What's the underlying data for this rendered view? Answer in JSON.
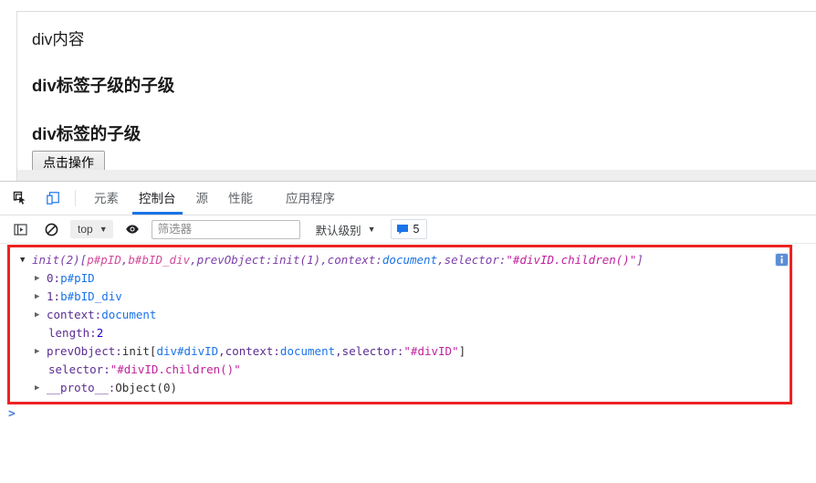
{
  "page": {
    "div_content": "div内容",
    "heading_child_of_child": "div标签子级的子级",
    "heading_child": "div标签的子级",
    "button_label": "点击操作"
  },
  "devtools": {
    "toolbar_icons": [
      {
        "name": "inspect-element-icon",
        "title": "检查元素"
      },
      {
        "name": "device-toolbar-icon",
        "title": "切换设备工具栏"
      }
    ],
    "tabs": [
      {
        "label": "元素",
        "selected": false
      },
      {
        "label": "控制台",
        "selected": true
      },
      {
        "label": "源",
        "selected": false
      },
      {
        "label": "性能",
        "selected": false
      },
      {
        "label": "应用程序",
        "selected": false
      }
    ],
    "console_toolbar": {
      "sidebar_toggle_icon": "console-sidebar-icon",
      "clear_icon": "clear-console-icon",
      "context_value": "top",
      "context_caret": "▼",
      "eye_icon": "live-expression-icon",
      "filter_placeholder": "筛选器",
      "filter_value": "",
      "levels_label": "默认级别",
      "levels_caret": "▼",
      "message_count": "5",
      "message_icon": "message-count-icon"
    },
    "console_output": {
      "line0": {
        "triangle": "▼",
        "object": "init(2)",
        "bracket_open": " [",
        "node1": "p#pID",
        "sep1": ", ",
        "node2": "b#bID_div",
        "sep2": ", ",
        "key_prev": "prevObject: ",
        "val_prev": "init(1)",
        "sep3": ", ",
        "key_ctx": "context: ",
        "val_ctx": "document",
        "sep4": ", ",
        "key_sel": "selector: ",
        "val_sel": "\"#divID.children()\"",
        "bracket_close": "]"
      },
      "rows": [
        {
          "triangle": "▶",
          "key": "0: ",
          "value": "p#pID",
          "value_kind": "node"
        },
        {
          "triangle": "▶",
          "key": "1: ",
          "value": "b#bID_div",
          "value_kind": "node"
        },
        {
          "triangle": "▶",
          "key": "context: ",
          "value": "document",
          "value_kind": "node"
        },
        {
          "triangle": "",
          "key": "length: ",
          "value": "2",
          "value_kind": "number"
        }
      ],
      "prevobject_row": {
        "triangle": "▶",
        "key": "prevObject: ",
        "ctor": "init ",
        "bracket_open": "[",
        "node": "div#divID",
        "sep1": ", ",
        "key_ctx": "context: ",
        "val_ctx": "document",
        "sep2": ", ",
        "key_sel": "selector: ",
        "val_sel": "\"#divID\"",
        "bracket_close": "]"
      },
      "selector_row": {
        "key": "selector: ",
        "value": "\"#divID.children()\""
      },
      "proto_row": {
        "triangle": "▶",
        "key": "__proto__: ",
        "value": "Object(0)"
      },
      "info_badge": "info-icon",
      "prompt_caret": ">"
    }
  },
  "colors": {
    "accent_blue": "#1a73e8",
    "annotation_red": "#ee2222",
    "object_purple": "#7c3ea8",
    "node_pink": "#d34a9b",
    "node_blue": "#1a73e8",
    "key_purple": "#5b2d91",
    "number_blue": "#1c00cf"
  }
}
